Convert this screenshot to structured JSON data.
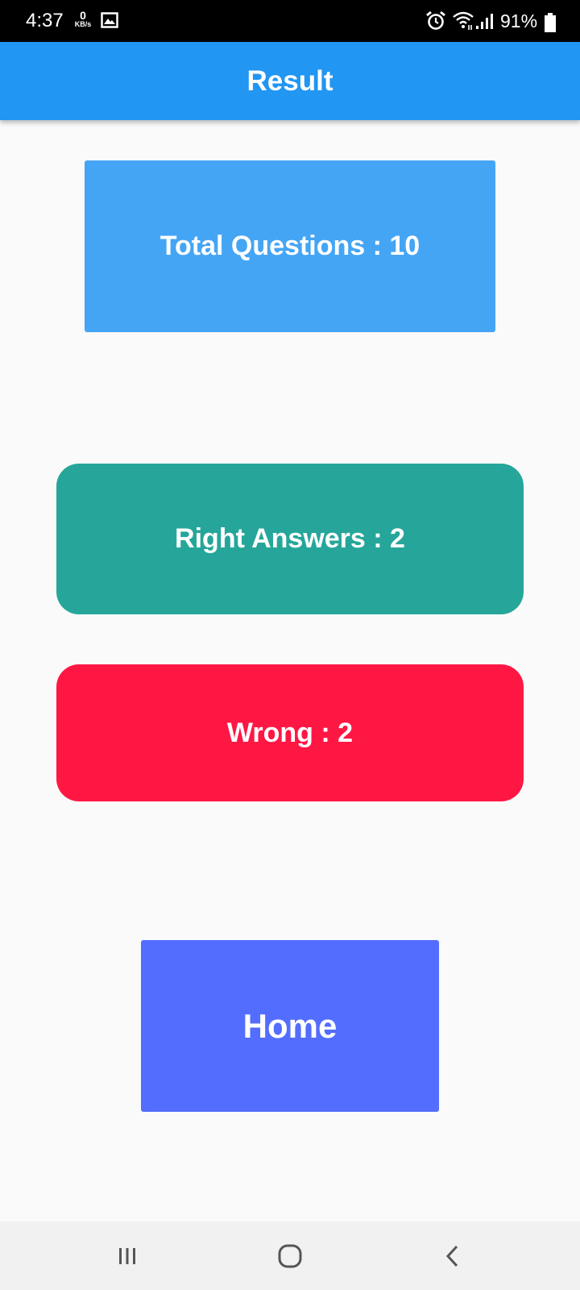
{
  "status_bar": {
    "time": "4:37",
    "net_speed_value": "0",
    "net_speed_unit": "KB/s",
    "battery_percent": "91%",
    "icons": [
      "gallery-icon",
      "alarm-icon",
      "wifi-icon",
      "signal-icon",
      "battery-icon"
    ]
  },
  "app_bar": {
    "title": "Result"
  },
  "result": {
    "total_questions": "Total Questions : 10",
    "right_answers": "Right Answers : 2",
    "wrong": "Wrong : 2"
  },
  "actions": {
    "home_label": "Home"
  },
  "nav_bar": {
    "icons": [
      "recents-icon",
      "home-circle-icon",
      "back-icon"
    ]
  },
  "colors": {
    "app_bar": "#2196f3",
    "total_card": "#45a5f5",
    "right_card": "#26a69a",
    "wrong_card": "#ff1744",
    "home_button": "#536dfe",
    "background": "#fafafa"
  }
}
